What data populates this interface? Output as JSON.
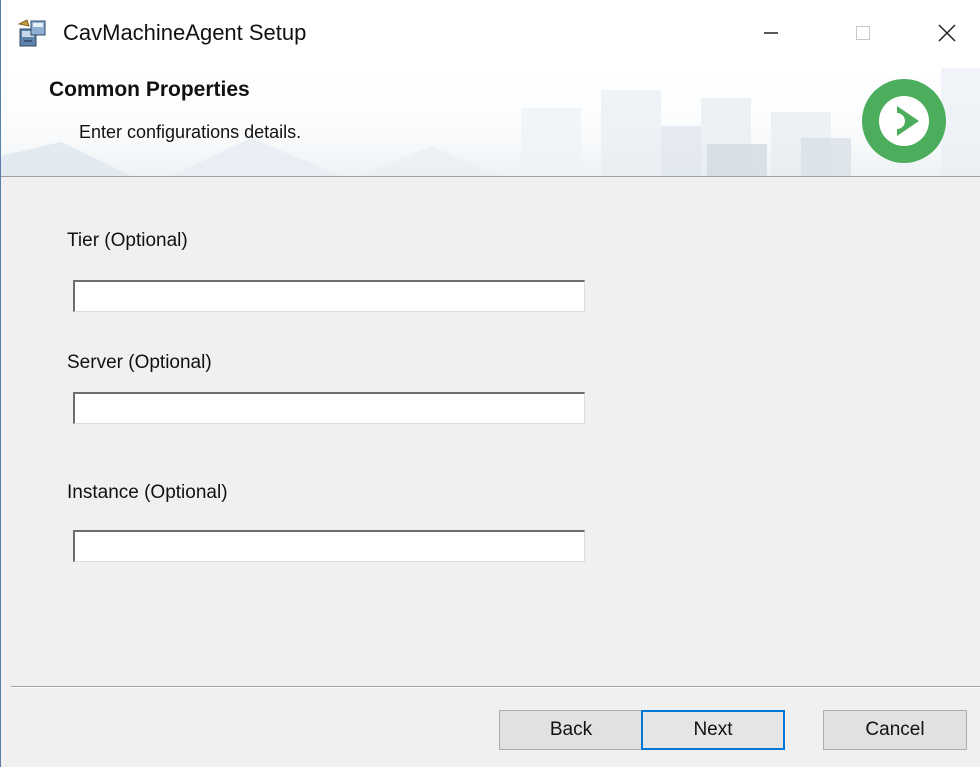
{
  "window": {
    "title": "CavMachineAgent Setup",
    "accent_color": "#0078d7",
    "icons": [
      "installer-icon",
      "minimize-icon",
      "maximize-icon",
      "close-icon",
      "brand-logo-icon"
    ]
  },
  "header": {
    "title": "Common Properties",
    "subtitle": "Enter configurations details.",
    "logo_color": "#4cae5c"
  },
  "form": {
    "fields": [
      {
        "label": "Tier (Optional)",
        "value": ""
      },
      {
        "label": "Server (Optional)",
        "value": ""
      },
      {
        "label": "Instance (Optional)",
        "value": ""
      }
    ]
  },
  "buttons": {
    "back": "Back",
    "next": "Next",
    "cancel": "Cancel"
  }
}
